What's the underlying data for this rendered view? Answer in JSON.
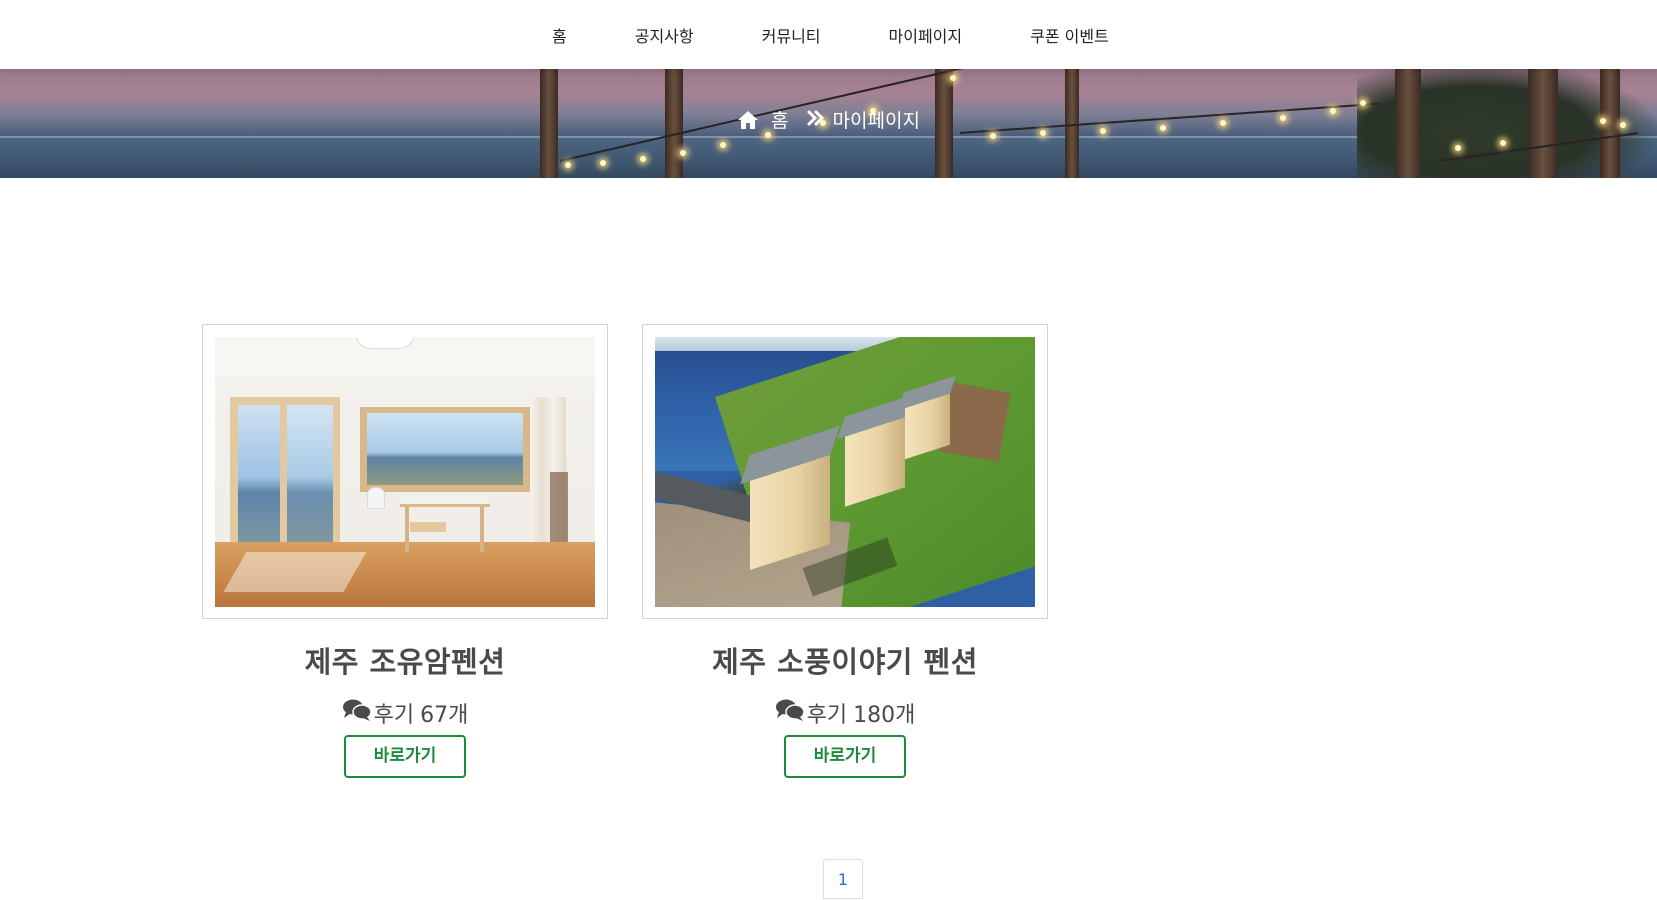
{
  "nav": {
    "items": [
      {
        "label": "홈"
      },
      {
        "label": "공지사항"
      },
      {
        "label": "커뮤니티"
      },
      {
        "label": "마이페이지"
      },
      {
        "label": "쿠폰 이벤트"
      }
    ]
  },
  "hero": {
    "breadcrumb": {
      "home_icon": "home-icon",
      "home_label": "홈",
      "separator_icon": "double-chevron-right-icon",
      "current_label": "마이페이지"
    }
  },
  "cards": [
    {
      "name": "제주 조유암펜션",
      "review_icon": "comments-icon",
      "review_prefix": "후기",
      "review_count": "67개",
      "button_label": "바로가기"
    },
    {
      "name": "제주 소풍이야기 펜션",
      "review_icon": "comments-icon",
      "review_prefix": "후기",
      "review_count": "180개",
      "button_label": "바로가기"
    }
  ],
  "pagination": {
    "pages": [
      "1"
    ],
    "current": "1"
  },
  "colors": {
    "accent_green": "#1e8a3c",
    "link_blue": "#2a6fd6",
    "text_dark": "#4a4a4a"
  }
}
